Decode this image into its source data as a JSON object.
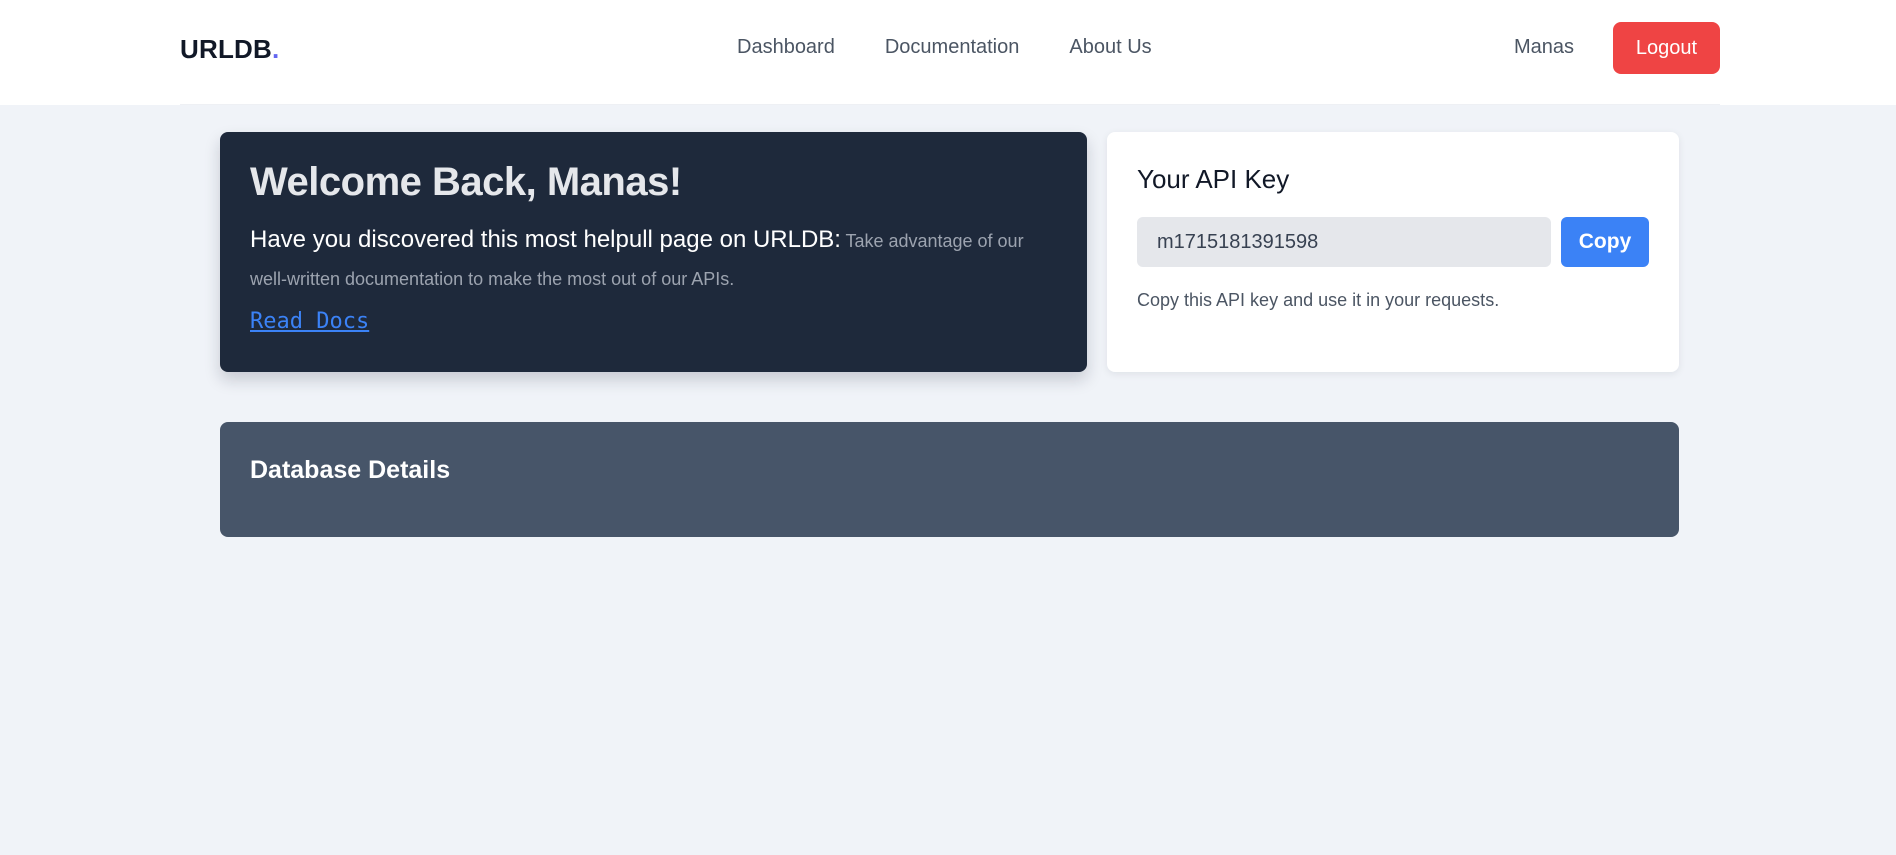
{
  "brand": {
    "name": "URLDB",
    "dot": ".",
    "accent": "#6366f1"
  },
  "nav": {
    "links": [
      {
        "label": "Dashboard"
      },
      {
        "label": "Documentation"
      },
      {
        "label": "About Us"
      }
    ],
    "user": "Manas",
    "logout_label": "Logout",
    "logout_color": "#ef4444"
  },
  "welcome": {
    "title": "Welcome Back, Manas!",
    "lead": "Have you discovered this most helpull page on URLDB:",
    "sub": "Take advantage of our well-written documentation to make the most out of our APIs.",
    "link_label": "Read Docs"
  },
  "api": {
    "title": "Your API Key",
    "key_value": "m1715181391598",
    "copy_label": "Copy",
    "help_text": "Copy this API key and use it in your requests."
  },
  "database": {
    "title": "Database Details"
  },
  "colors": {
    "page_bg": "#f0f3f8",
    "welcome_bg": "#1e293b",
    "database_bg": "#475569",
    "link": "#3b82f6"
  }
}
